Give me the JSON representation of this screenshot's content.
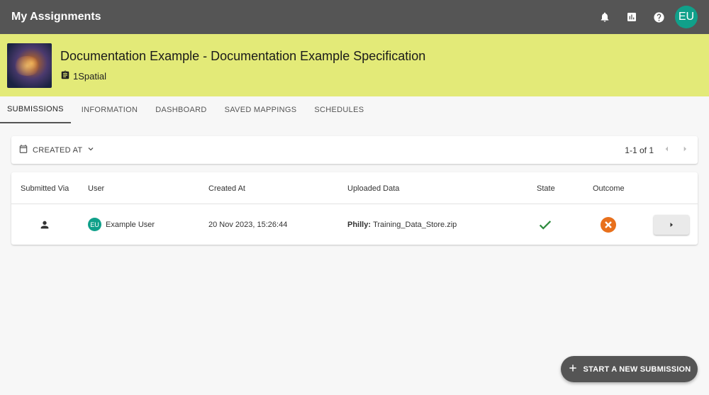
{
  "appbar": {
    "title": "My Assignments",
    "avatar_initials": "EU",
    "icons": [
      "bell-icon",
      "chart-icon",
      "help-icon"
    ]
  },
  "banner": {
    "title": "Documentation Example - Documentation Example Specification",
    "org": "1Spatial"
  },
  "tabs": [
    {
      "label": "SUBMISSIONS",
      "active": true
    },
    {
      "label": "INFORMATION",
      "active": false
    },
    {
      "label": "DASHBOARD",
      "active": false
    },
    {
      "label": "SAVED MAPPINGS",
      "active": false
    },
    {
      "label": "SCHEDULES",
      "active": false
    }
  ],
  "filter": {
    "sort_label": "CREATED AT",
    "pager_text": "1-1 of 1"
  },
  "table": {
    "headers": {
      "submitted_via": "Submitted Via",
      "user": "User",
      "created_at": "Created At",
      "uploaded_data": "Uploaded Data",
      "state": "State",
      "outcome": "Outcome"
    },
    "rows": [
      {
        "user_initials": "EU",
        "user_name": "Example User",
        "created_at": "20 Nov 2023, 15:26:44",
        "data_prefix": "Philly:",
        "data_file": "Training_Data_Store.zip",
        "state": "success",
        "outcome": "failed"
      }
    ]
  },
  "fab": {
    "label": "START A NEW SUBMISSION"
  },
  "colors": {
    "appbar": "#555555",
    "banner": "#e3ea78",
    "avatar": "#10a08a",
    "success": "#2e8b3e",
    "error": "#e8701c"
  }
}
